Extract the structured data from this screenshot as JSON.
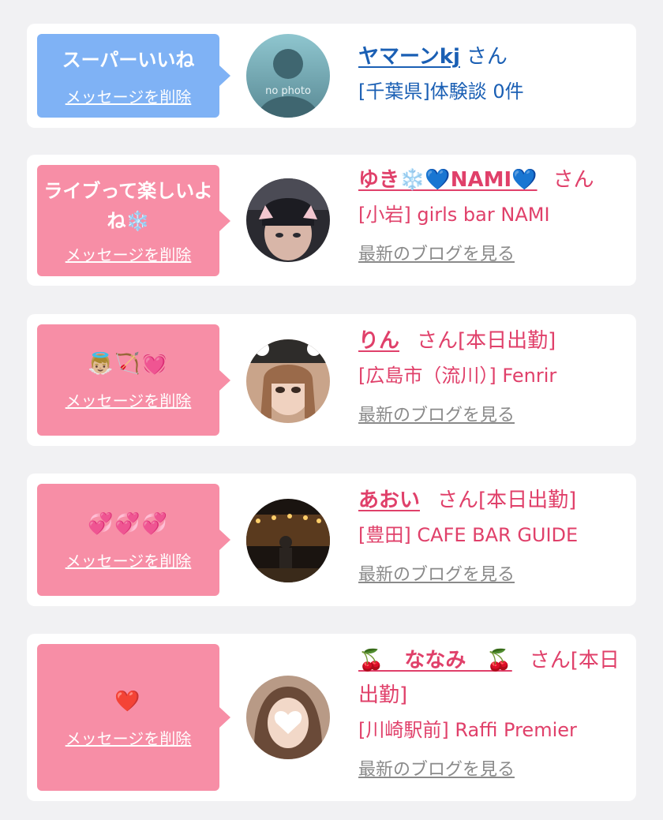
{
  "delete_label": "メッセージを削除",
  "blog_label": "最新のブログを見る",
  "cards": [
    {
      "bubble_text": "スーパーいいね",
      "name": "ヤマーンkj",
      "suffix": "さん",
      "store": "[千葉県]体験談 0件"
    },
    {
      "bubble_text": "ライブって楽しいよね❄️",
      "name": "ゆき❄️💙NAMI💙",
      "suffix": "さん",
      "store": "[小岩] girls bar NAMI"
    },
    {
      "bubble_text": "👼🏼🏹💓",
      "name": "りん",
      "suffix": "さん[本日出勤]",
      "store": "[広島市（流川）] Fenrir"
    },
    {
      "bubble_text": "💞💞💞",
      "name": "あおい",
      "suffix": "さん[本日出勤]",
      "store": "[豊田] CAFE BAR GUIDE"
    },
    {
      "bubble_text": "❤️",
      "name": "🍒　ななみ　🍒",
      "suffix": "さん[本日出勤]",
      "store": "[川崎駅前] Raffi Premier"
    }
  ],
  "no_photo_text": "no photo",
  "colors": {
    "background": "#f1f1f3",
    "bubble_blue": "#7fb2f5",
    "bubble_pink": "#f78ea6",
    "text_blue": "#1a5fb4",
    "text_pink": "#e0406a",
    "link_gray": "#8a8a8a"
  }
}
